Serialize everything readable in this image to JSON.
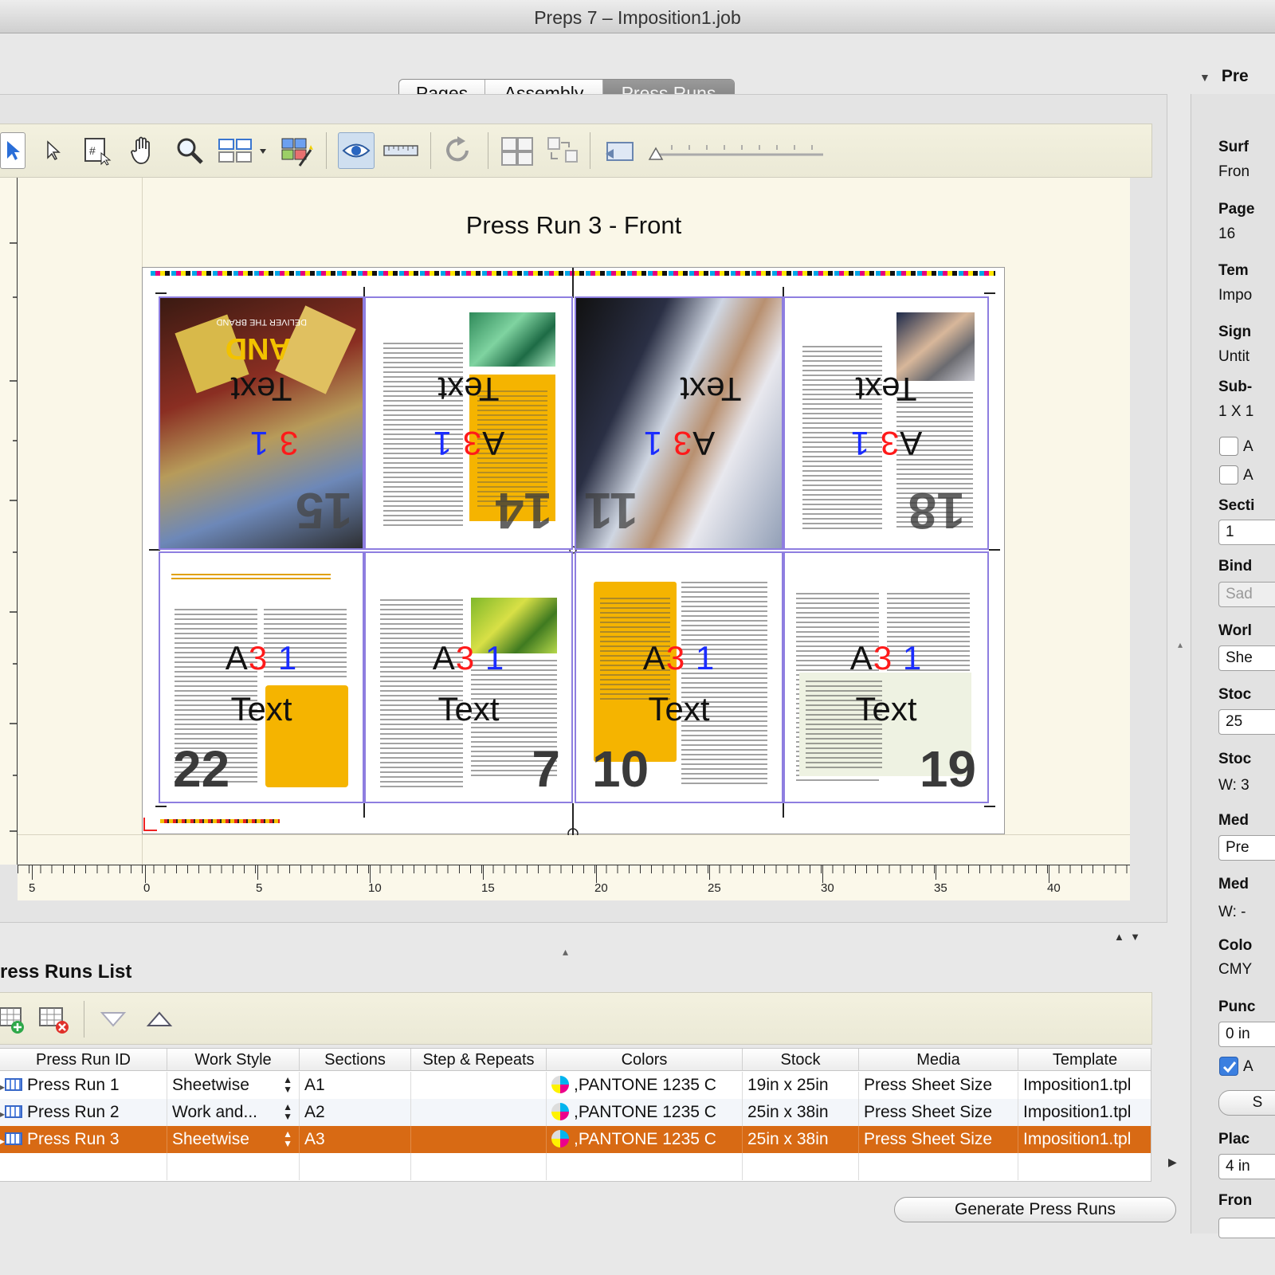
{
  "window": {
    "title": "Preps 7 – Imposition1.job"
  },
  "tabs": [
    {
      "label": "Pages",
      "active": false
    },
    {
      "label": "Assembly",
      "active": false
    },
    {
      "label": "Press Runs",
      "active": true
    }
  ],
  "canvas": {
    "title": "Press Run 3 - Front",
    "pages": [
      {
        "number": "15",
        "label_a": "A",
        "label_3": "3",
        "label_1": "1",
        "overlay": "Text",
        "rotated": true
      },
      {
        "number": "14",
        "label_a": "A",
        "label_3": "3",
        "label_1": "1",
        "overlay": "Text",
        "rotated": true
      },
      {
        "number": "11",
        "label_a": "A",
        "label_3": "3",
        "label_1": "1",
        "overlay": "Text",
        "rotated": true
      },
      {
        "number": "18",
        "label_a": "A",
        "label_3": "3",
        "label_1": "1",
        "overlay": "Text",
        "rotated": true
      },
      {
        "number": "22",
        "label_a": "A",
        "label_3": "3",
        "label_1": "1",
        "overlay": "Text",
        "rotated": false
      },
      {
        "number": "7",
        "label_a": "A",
        "label_3": "3",
        "label_1": "1",
        "overlay": "Text",
        "rotated": false
      },
      {
        "number": "10",
        "label_a": "A",
        "label_3": "3",
        "label_1": "1",
        "overlay": "Text",
        "rotated": false
      },
      {
        "number": "19",
        "label_a": "A",
        "label_3": "3",
        "label_1": "1",
        "overlay": "Text",
        "rotated": false
      }
    ],
    "cover_text": {
      "line1": "AND",
      "line2": "DELIVER THE BRAND"
    }
  },
  "ruler": {
    "labels": [
      "5",
      "0",
      "5",
      "10",
      "15",
      "20",
      "25",
      "30",
      "35",
      "40"
    ]
  },
  "press_runs_list": {
    "title": "ress Runs List",
    "columns": [
      "Press Run ID",
      "Work Style",
      "Sections",
      "Step & Repeats",
      "Colors",
      "Stock",
      "Media",
      "Template"
    ],
    "rows": [
      {
        "id": "Press Run 1",
        "work_style": "Sheetwise",
        "sections": "A1",
        "step_repeats": "",
        "colors": ",PANTONE 1235 C",
        "stock": "19in x 25in",
        "media": "Press Sheet Size",
        "template": "Imposition1.tpl",
        "selected": false
      },
      {
        "id": "Press Run 2",
        "work_style": "Work and...",
        "sections": "A2",
        "step_repeats": "",
        "colors": ",PANTONE 1235 C",
        "stock": "25in x 38in",
        "media": "Press Sheet Size",
        "template": "Imposition1.tpl",
        "selected": false
      },
      {
        "id": "Press Run 3",
        "work_style": "Sheetwise",
        "sections": "A3",
        "step_repeats": "",
        "colors": ",PANTONE 1235 C",
        "stock": "25in x 38in",
        "media": "Press Sheet Size",
        "template": "Imposition1.tpl",
        "selected": true
      }
    ],
    "generate_button": "Generate Press Runs"
  },
  "right_panel": {
    "header": "Pre",
    "items": [
      {
        "label": "Surf",
        "value": "Fron"
      },
      {
        "label": "Page",
        "value": "16"
      },
      {
        "label": "Tem",
        "value": "Impo"
      },
      {
        "label": "Sign",
        "value": "Untit"
      },
      {
        "label": "Sub-",
        "value": "1 X 1"
      },
      {
        "label": "Secti",
        "value": "1"
      },
      {
        "label": "Bind",
        "value": "Sad"
      },
      {
        "label": "Worl",
        "value": "She"
      },
      {
        "label": "Stoc",
        "value": "25"
      },
      {
        "label": "Stoc",
        "value": "W: 3"
      },
      {
        "label": "Med",
        "value": "Pre"
      },
      {
        "label": "Med",
        "value": "W: -"
      },
      {
        "label": "Colo",
        "value": "CMY"
      },
      {
        "label": "Punc",
        "value": "0 in"
      },
      {
        "label": "Plac",
        "value": "4 in"
      },
      {
        "label": "Fron",
        "value": ""
      }
    ],
    "checkboxes": [
      {
        "label": "A"
      },
      {
        "label": "A"
      },
      {
        "label": "A"
      }
    ],
    "button_label": "S"
  },
  "colors": {
    "selected_row": "#d86a14",
    "accent_red": "#ff1a1a",
    "accent_blue": "#1a2cff",
    "guide_purple": "#8e7ee0",
    "yellow_block": "#f5b400"
  }
}
